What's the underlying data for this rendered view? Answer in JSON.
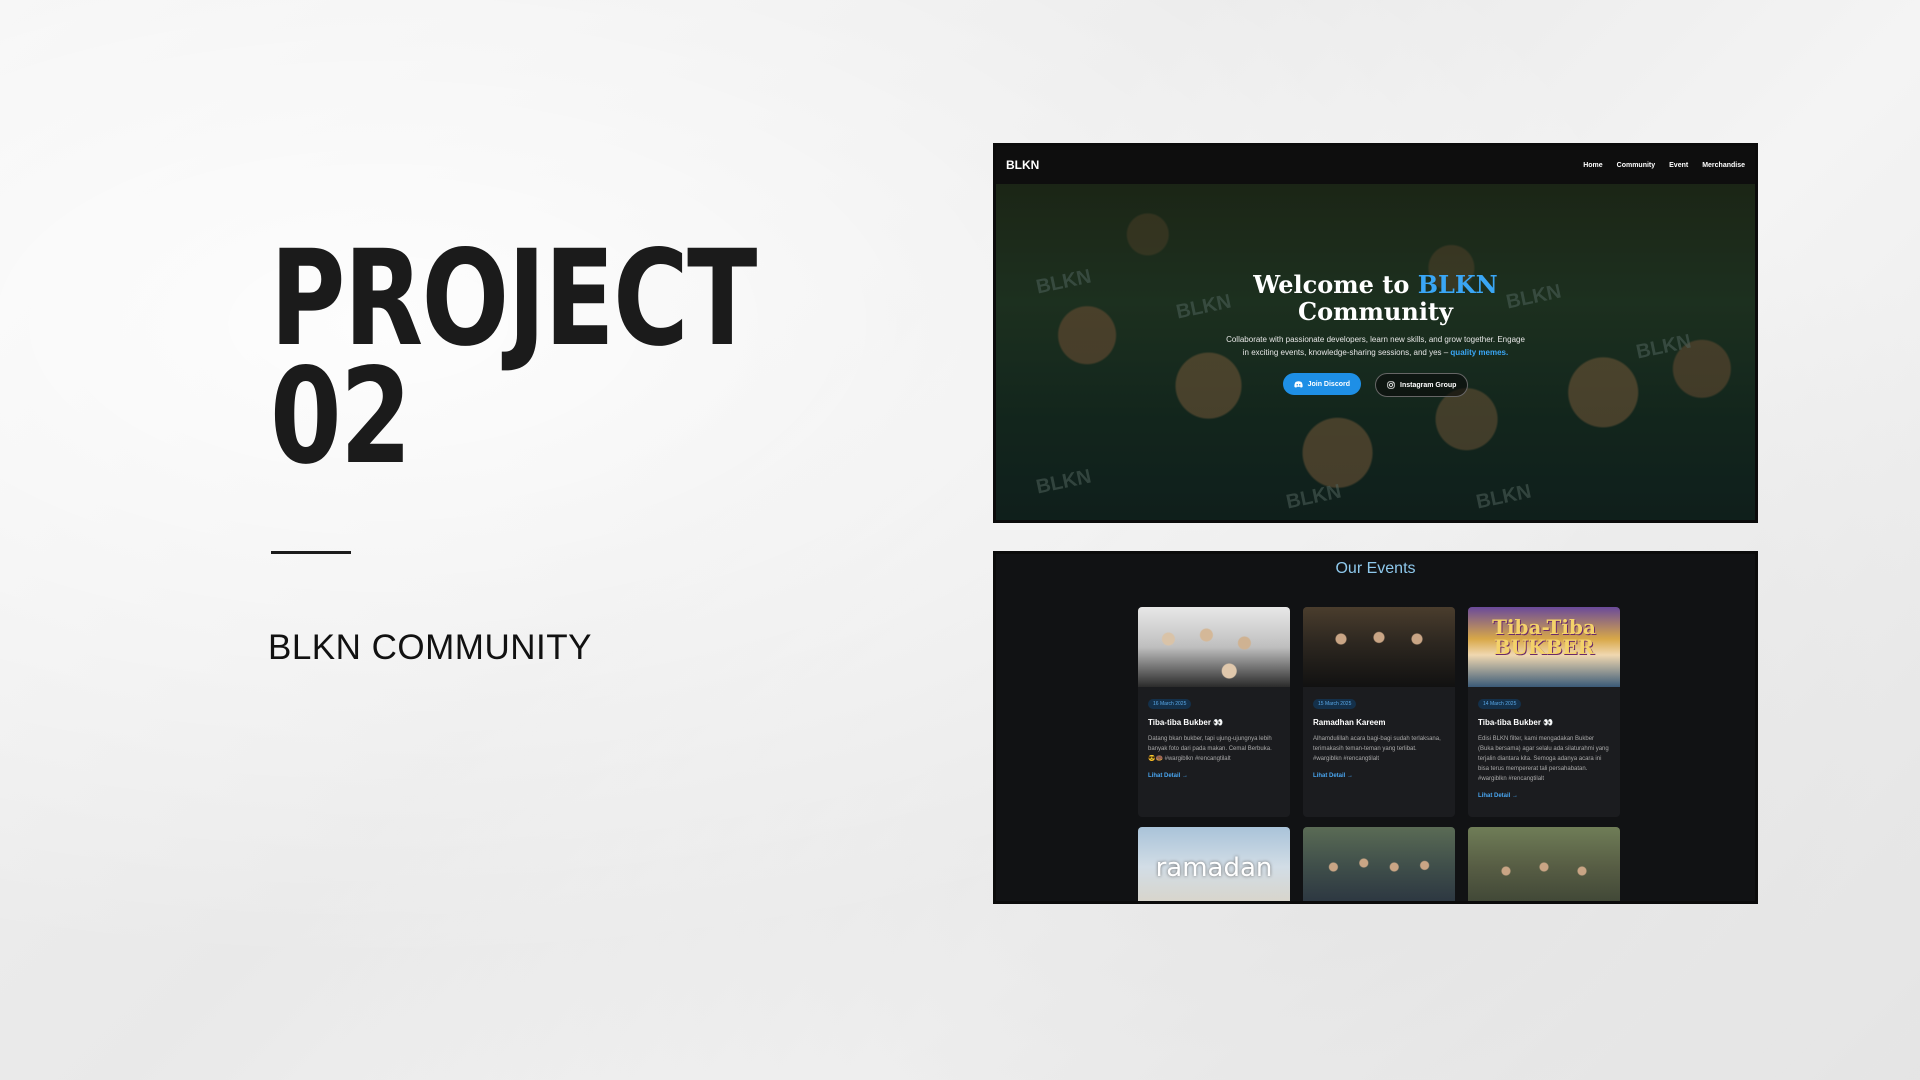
{
  "slide": {
    "title_line1": "PROJECT",
    "title_line2": "02",
    "subtitle": "BLKN COMMUNITY"
  },
  "hero": {
    "brand": "BLKN",
    "nav": [
      "Home",
      "Community",
      "Event",
      "Merchandise"
    ],
    "heading_part1": "Welcome to ",
    "heading_accent": "BLKN",
    "heading_part2": "Community",
    "description": "Collaborate with passionate developers, learn new skills, and grow together. Engage in exciting events, knowledge-sharing sessions, and yes – ",
    "description_highlight": "quality memes.",
    "primary_button": "Join Discord",
    "secondary_button": "Instagram Group",
    "cap_text": "BLKN"
  },
  "events": {
    "heading": "Our Events",
    "cards": [
      {
        "date": "16 March 2025",
        "title": "Tiba-tiba Bukber 👀",
        "description": "Datang bkan bukber, tapi ujung-ujungnya lebih banyak foto dari pada makan. Cemal Berbuka. 😎🍩 #wargiblkn #rencangtilalt",
        "link": "Lihat Detail →"
      },
      {
        "date": "15 March 2025",
        "title": "Ramadhan Kareem",
        "description": "Alhamdulillah acara bagi-bagi sudah terlaksana, terimakasih teman-teman yang terlibat. #wargiblkn #rencangtilalt",
        "link": "Lihat Detail →"
      },
      {
        "date": "14 March 2025",
        "title": "Tiba-tiba Bukber 👀",
        "description": "Edisi BLKN filter, kami mengadakan Bukber (Buka bersama) agar selalu ada silaturahmi yang terjalin diantara kita. Semoga adanya acara ini bisa terus mempererat tali persahabatan. #wargiblkn #rencangtilalt",
        "link": "Lihat Detail →",
        "image_text": "Tiba-Tiba BUKBER"
      }
    ],
    "bottom_image_text": "ramadan"
  },
  "colors": {
    "accent": "#3aa6f5",
    "button": "#1e8fe6",
    "events_heading": "#8ec8ec"
  }
}
